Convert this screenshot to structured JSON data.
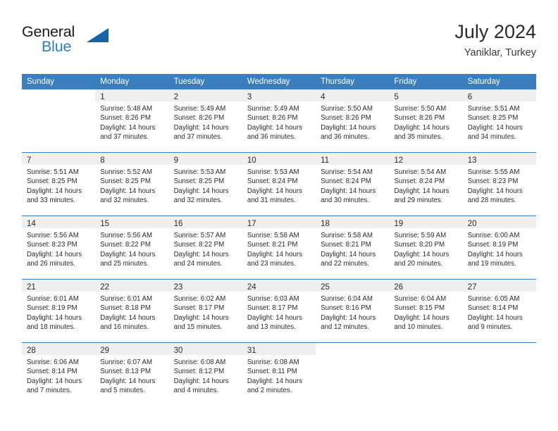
{
  "brand": {
    "name_part1": "General",
    "name_part2": "Blue",
    "triangle_color": "#1763a6",
    "blue_color": "#2b7cc2"
  },
  "header": {
    "month_year": "July 2024",
    "location": "Yaniklar, Turkey"
  },
  "theme": {
    "header_bar": "#3a7ebf",
    "daynum_band": "#efefef",
    "row_separator": "#3a7ebf",
    "text": "#2b2b2b"
  },
  "weekday_headers": [
    "Sunday",
    "Monday",
    "Tuesday",
    "Wednesday",
    "Thursday",
    "Friday",
    "Saturday"
  ],
  "weeks": [
    [
      {
        "empty": true
      },
      {
        "day": "1",
        "sunrise": "Sunrise: 5:48 AM",
        "sunset": "Sunset: 8:26 PM",
        "daylight1": "Daylight: 14 hours",
        "daylight2": "and 37 minutes."
      },
      {
        "day": "2",
        "sunrise": "Sunrise: 5:49 AM",
        "sunset": "Sunset: 8:26 PM",
        "daylight1": "Daylight: 14 hours",
        "daylight2": "and 37 minutes."
      },
      {
        "day": "3",
        "sunrise": "Sunrise: 5:49 AM",
        "sunset": "Sunset: 8:26 PM",
        "daylight1": "Daylight: 14 hours",
        "daylight2": "and 36 minutes."
      },
      {
        "day": "4",
        "sunrise": "Sunrise: 5:50 AM",
        "sunset": "Sunset: 8:26 PM",
        "daylight1": "Daylight: 14 hours",
        "daylight2": "and 36 minutes."
      },
      {
        "day": "5",
        "sunrise": "Sunrise: 5:50 AM",
        "sunset": "Sunset: 8:26 PM",
        "daylight1": "Daylight: 14 hours",
        "daylight2": "and 35 minutes."
      },
      {
        "day": "6",
        "sunrise": "Sunrise: 5:51 AM",
        "sunset": "Sunset: 8:25 PM",
        "daylight1": "Daylight: 14 hours",
        "daylight2": "and 34 minutes."
      }
    ],
    [
      {
        "day": "7",
        "sunrise": "Sunrise: 5:51 AM",
        "sunset": "Sunset: 8:25 PM",
        "daylight1": "Daylight: 14 hours",
        "daylight2": "and 33 minutes."
      },
      {
        "day": "8",
        "sunrise": "Sunrise: 5:52 AM",
        "sunset": "Sunset: 8:25 PM",
        "daylight1": "Daylight: 14 hours",
        "daylight2": "and 32 minutes."
      },
      {
        "day": "9",
        "sunrise": "Sunrise: 5:53 AM",
        "sunset": "Sunset: 8:25 PM",
        "daylight1": "Daylight: 14 hours",
        "daylight2": "and 32 minutes."
      },
      {
        "day": "10",
        "sunrise": "Sunrise: 5:53 AM",
        "sunset": "Sunset: 8:24 PM",
        "daylight1": "Daylight: 14 hours",
        "daylight2": "and 31 minutes."
      },
      {
        "day": "11",
        "sunrise": "Sunrise: 5:54 AM",
        "sunset": "Sunset: 8:24 PM",
        "daylight1": "Daylight: 14 hours",
        "daylight2": "and 30 minutes."
      },
      {
        "day": "12",
        "sunrise": "Sunrise: 5:54 AM",
        "sunset": "Sunset: 8:24 PM",
        "daylight1": "Daylight: 14 hours",
        "daylight2": "and 29 minutes."
      },
      {
        "day": "13",
        "sunrise": "Sunrise: 5:55 AM",
        "sunset": "Sunset: 8:23 PM",
        "daylight1": "Daylight: 14 hours",
        "daylight2": "and 28 minutes."
      }
    ],
    [
      {
        "day": "14",
        "sunrise": "Sunrise: 5:56 AM",
        "sunset": "Sunset: 8:23 PM",
        "daylight1": "Daylight: 14 hours",
        "daylight2": "and 26 minutes."
      },
      {
        "day": "15",
        "sunrise": "Sunrise: 5:56 AM",
        "sunset": "Sunset: 8:22 PM",
        "daylight1": "Daylight: 14 hours",
        "daylight2": "and 25 minutes."
      },
      {
        "day": "16",
        "sunrise": "Sunrise: 5:57 AM",
        "sunset": "Sunset: 8:22 PM",
        "daylight1": "Daylight: 14 hours",
        "daylight2": "and 24 minutes."
      },
      {
        "day": "17",
        "sunrise": "Sunrise: 5:58 AM",
        "sunset": "Sunset: 8:21 PM",
        "daylight1": "Daylight: 14 hours",
        "daylight2": "and 23 minutes."
      },
      {
        "day": "18",
        "sunrise": "Sunrise: 5:58 AM",
        "sunset": "Sunset: 8:21 PM",
        "daylight1": "Daylight: 14 hours",
        "daylight2": "and 22 minutes."
      },
      {
        "day": "19",
        "sunrise": "Sunrise: 5:59 AM",
        "sunset": "Sunset: 8:20 PM",
        "daylight1": "Daylight: 14 hours",
        "daylight2": "and 20 minutes."
      },
      {
        "day": "20",
        "sunrise": "Sunrise: 6:00 AM",
        "sunset": "Sunset: 8:19 PM",
        "daylight1": "Daylight: 14 hours",
        "daylight2": "and 19 minutes."
      }
    ],
    [
      {
        "day": "21",
        "sunrise": "Sunrise: 6:01 AM",
        "sunset": "Sunset: 8:19 PM",
        "daylight1": "Daylight: 14 hours",
        "daylight2": "and 18 minutes."
      },
      {
        "day": "22",
        "sunrise": "Sunrise: 6:01 AM",
        "sunset": "Sunset: 8:18 PM",
        "daylight1": "Daylight: 14 hours",
        "daylight2": "and 16 minutes."
      },
      {
        "day": "23",
        "sunrise": "Sunrise: 6:02 AM",
        "sunset": "Sunset: 8:17 PM",
        "daylight1": "Daylight: 14 hours",
        "daylight2": "and 15 minutes."
      },
      {
        "day": "24",
        "sunrise": "Sunrise: 6:03 AM",
        "sunset": "Sunset: 8:17 PM",
        "daylight1": "Daylight: 14 hours",
        "daylight2": "and 13 minutes."
      },
      {
        "day": "25",
        "sunrise": "Sunrise: 6:04 AM",
        "sunset": "Sunset: 8:16 PM",
        "daylight1": "Daylight: 14 hours",
        "daylight2": "and 12 minutes."
      },
      {
        "day": "26",
        "sunrise": "Sunrise: 6:04 AM",
        "sunset": "Sunset: 8:15 PM",
        "daylight1": "Daylight: 14 hours",
        "daylight2": "and 10 minutes."
      },
      {
        "day": "27",
        "sunrise": "Sunrise: 6:05 AM",
        "sunset": "Sunset: 8:14 PM",
        "daylight1": "Daylight: 14 hours",
        "daylight2": "and 9 minutes."
      }
    ],
    [
      {
        "day": "28",
        "sunrise": "Sunrise: 6:06 AM",
        "sunset": "Sunset: 8:14 PM",
        "daylight1": "Daylight: 14 hours",
        "daylight2": "and 7 minutes."
      },
      {
        "day": "29",
        "sunrise": "Sunrise: 6:07 AM",
        "sunset": "Sunset: 8:13 PM",
        "daylight1": "Daylight: 14 hours",
        "daylight2": "and 5 minutes."
      },
      {
        "day": "30",
        "sunrise": "Sunrise: 6:08 AM",
        "sunset": "Sunset: 8:12 PM",
        "daylight1": "Daylight: 14 hours",
        "daylight2": "and 4 minutes."
      },
      {
        "day": "31",
        "sunrise": "Sunrise: 6:08 AM",
        "sunset": "Sunset: 8:11 PM",
        "daylight1": "Daylight: 14 hours",
        "daylight2": "and 2 minutes."
      },
      {
        "empty": true
      },
      {
        "empty": true
      },
      {
        "empty": true
      }
    ]
  ]
}
